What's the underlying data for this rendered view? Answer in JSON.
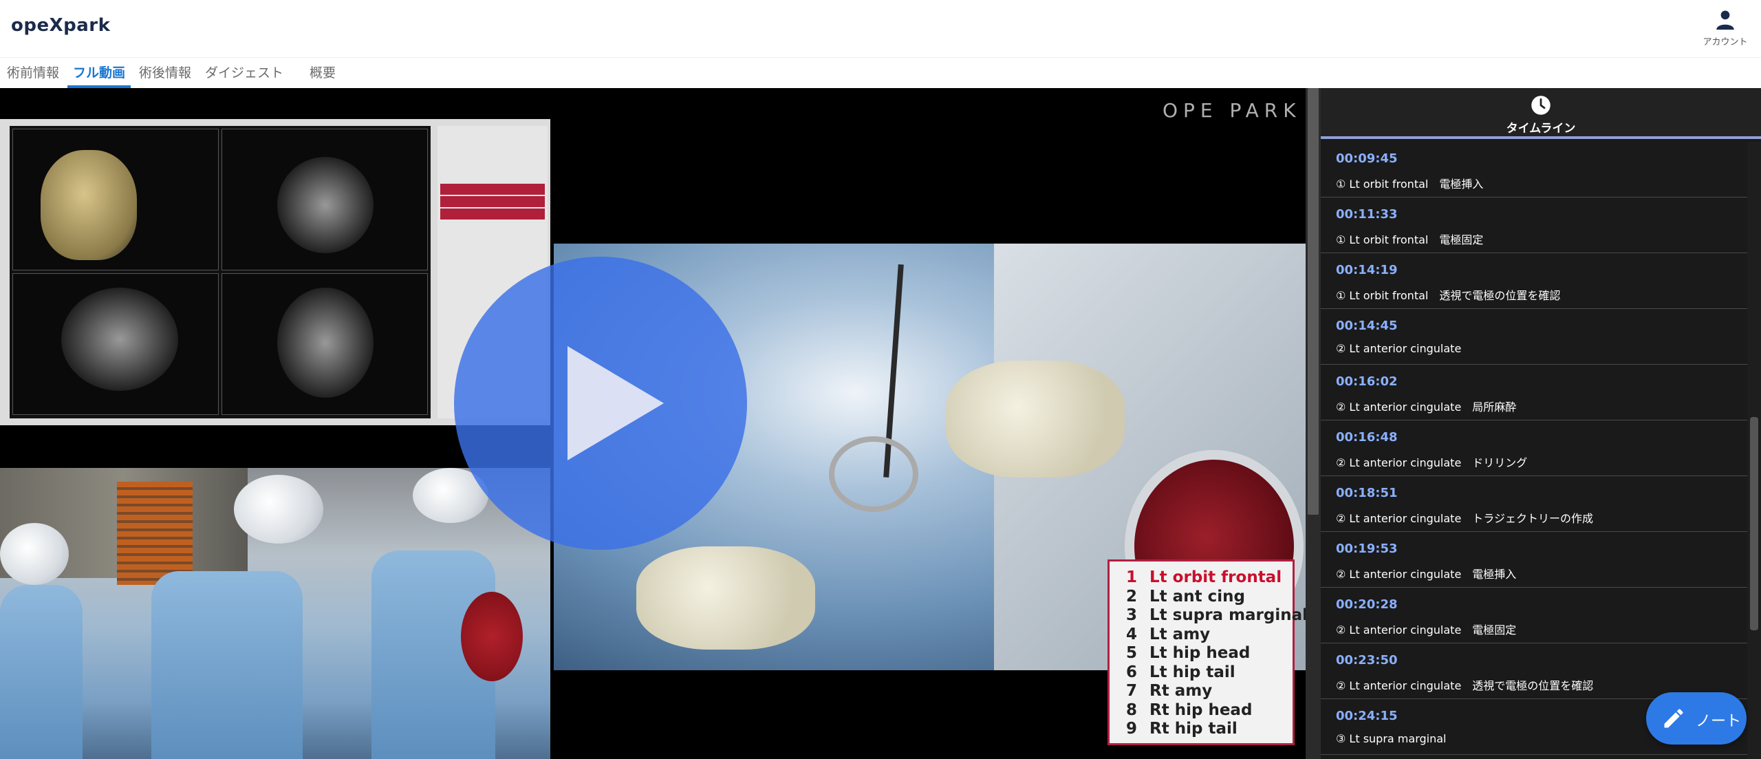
{
  "app": {
    "logo": "opeXpark"
  },
  "account": {
    "label": "アカウント",
    "icon": "user-icon"
  },
  "tabs": [
    {
      "label": "術前情報",
      "active": false
    },
    {
      "label": "フル動画",
      "active": true
    },
    {
      "label": "術後情報",
      "active": false
    },
    {
      "label": "ダイジェスト",
      "active": false
    },
    {
      "label": "概要",
      "active": false
    }
  ],
  "video": {
    "watermark": "OPE PARK",
    "play_icon": "play-icon",
    "target_list": [
      {
        "num": "1",
        "label": "Lt orbit frontal",
        "current": true
      },
      {
        "num": "2",
        "label": "Lt ant cing",
        "current": false
      },
      {
        "num": "3",
        "label": "Lt supra marginal",
        "current": false
      },
      {
        "num": "4",
        "label": "Lt amy",
        "current": false
      },
      {
        "num": "5",
        "label": "Lt hip head",
        "current": false
      },
      {
        "num": "6",
        "label": "Lt hip tail",
        "current": false
      },
      {
        "num": "7",
        "label": "Rt amy",
        "current": false
      },
      {
        "num": "8",
        "label": "Rt hip head",
        "current": false
      },
      {
        "num": "9",
        "label": "Rt hip tail",
        "current": false
      }
    ]
  },
  "timeline": {
    "title": "タイムライン",
    "icon": "clock-icon",
    "items": [
      {
        "time": "00:09:45",
        "text": "① Lt orbit frontal　電極挿入"
      },
      {
        "time": "00:11:33",
        "text": "① Lt orbit frontal　電極固定"
      },
      {
        "time": "00:14:19",
        "text": "① Lt orbit frontal　透視で電極の位置を確認"
      },
      {
        "time": "00:14:45",
        "text": "② Lt anterior cingulate"
      },
      {
        "time": "00:16:02",
        "text": "② Lt anterior cingulate　局所麻酔"
      },
      {
        "time": "00:16:48",
        "text": "② Lt anterior cingulate　ドリリング"
      },
      {
        "time": "00:18:51",
        "text": "② Lt anterior cingulate　トラジェクトリーの作成"
      },
      {
        "time": "00:19:53",
        "text": "② Lt anterior cingulate　電極挿入"
      },
      {
        "time": "00:20:28",
        "text": "② Lt anterior cingulate　電極固定"
      },
      {
        "time": "00:23:50",
        "text": "② Lt anterior cingulate　透視で電極の位置を確認"
      },
      {
        "time": "00:24:15",
        "text": "③ Lt supra marginal"
      }
    ]
  },
  "note_button": {
    "label": "ノート",
    "icon": "pencil-icon"
  },
  "colors": {
    "accent": "#1976d2",
    "timeline_time": "#8ab0ff",
    "play": "#3a70e8",
    "target_current": "#c8102e"
  }
}
